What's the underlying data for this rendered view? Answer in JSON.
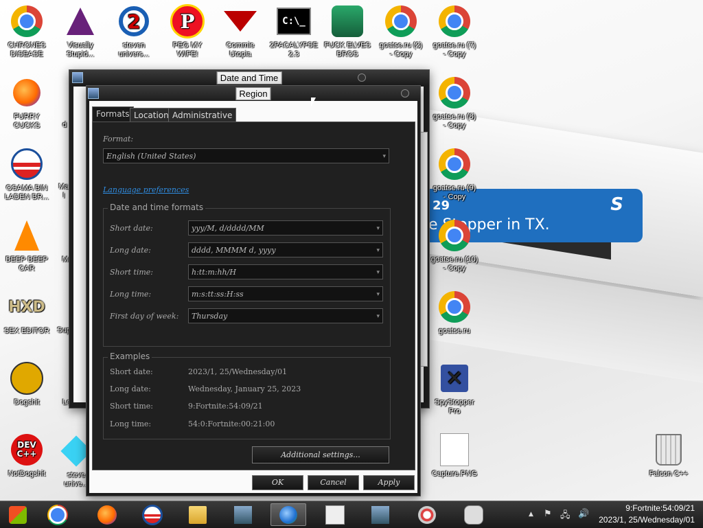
{
  "desktop": {
    "banner": {
      "num": "29",
      "letter": "S",
      "text": "e Stopper in TX."
    },
    "icons": [
      {
        "label": "CHRONES\nDISEASE",
        "icon": "chrome-icon"
      },
      {
        "label": "Visually\nStupid...",
        "icon": "visual-studio-icon"
      },
      {
        "label": "steven\nunivers...",
        "icon": "steven-universe-icon"
      },
      {
        "label": "PEG MY WIFE!",
        "icon": "p-badge-icon"
      },
      {
        "label": "Commie\nUtopia",
        "icon": "hammer-sickle-icon"
      },
      {
        "label": "2PACALYPSE\n2.3",
        "icon": "command-prompt-icon"
      },
      {
        "label": "FUCK ELVES\nBROS",
        "icon": "elf-icon"
      },
      {
        "label": "goatse.ru (2)\n- Copy",
        "icon": "chrome-icon"
      },
      {
        "label": "goatse.ru (7)\n- Copy",
        "icon": "chrome-icon"
      },
      {
        "label": "FURRY CUCKS",
        "icon": "firefox-icon"
      },
      {
        "label": "goatse.ru (8)\n- Copy",
        "icon": "chrome-icon"
      },
      {
        "label": "OSAMA BIN\nLADEN BR...",
        "icon": "obama-logo-icon"
      },
      {
        "label": "goatse.ru (9)\n- Copy",
        "icon": "chrome-icon"
      },
      {
        "label": "BEEP BEEP\nCAR",
        "icon": "vlc-cone-icon"
      },
      {
        "label": "goatse.ru (10)\n- Copy",
        "icon": "chrome-icon"
      },
      {
        "label": "SEX EDITOR",
        "icon": "hex-editor-icon"
      },
      {
        "label": "goatse.ru",
        "icon": "chrome-icon"
      },
      {
        "label": "Dogshit",
        "icon": "cpp-builder-icon"
      },
      {
        "label": "SpyStopper\nPro",
        "icon": "spystopper-icon"
      },
      {
        "label": "NotDogshit",
        "icon": "dev-cpp-icon"
      },
      {
        "label": "steve\nunive...",
        "icon": "gem-icon"
      },
      {
        "label": "Capture.PNG",
        "icon": "image-file-icon"
      },
      {
        "label": "Falcon C++",
        "icon": "recycle-bin-icon"
      }
    ],
    "partial_labels": {
      "a": "d",
      "b": "Ma\nI",
      "c": "M",
      "d": "Sup",
      "e": "Le",
      "f": ")"
    }
  },
  "datetime_window": {
    "title": "Date and Time"
  },
  "region_window": {
    "title": "Region",
    "tabs": [
      "Formats",
      "Location",
      "Administrative"
    ],
    "format_label": "Format:",
    "format_value": "English (United States)",
    "language_link": "Language preferences",
    "datetime_group_title": "Date and time formats",
    "fields": [
      {
        "label": "Short date:",
        "value": "yyy/M, d/dddd/MM"
      },
      {
        "label": "Long date:",
        "value": "dddd, MMMM d, yyyy"
      },
      {
        "label": "Short time:",
        "value": "h:tt:m:hh/H"
      },
      {
        "label": "Long time:",
        "value": "m:s:tt:ss:H:ss"
      },
      {
        "label": "First day of week:",
        "value": "Thursday"
      }
    ],
    "examples_title": "Examples",
    "examples": [
      {
        "label": "Short date:",
        "value": "2023/1, 25/Wednesday/01"
      },
      {
        "label": "Long date:",
        "value": "Wednesday, January 25, 2023"
      },
      {
        "label": "Short time:",
        "value": "9:Fortnite:54:09/21"
      },
      {
        "label": "Long time:",
        "value": "54:0:Fortnite:00:21:00"
      }
    ],
    "additional_settings": "Additional settings...",
    "ok": "OK",
    "cancel": "Cancel",
    "apply": "Apply"
  },
  "taskbar": {
    "items": [
      "start-button",
      "chrome",
      "firefox",
      "obama-app",
      "file-explorer",
      "control-panel",
      "region-globe",
      "date-time",
      "network-app",
      "paint",
      "game-controller"
    ],
    "clock_time": "9:Fortnite:54:09/21",
    "clock_date": "2023/1, 25/Wednesday/01",
    "tray_arrow": "▲"
  }
}
